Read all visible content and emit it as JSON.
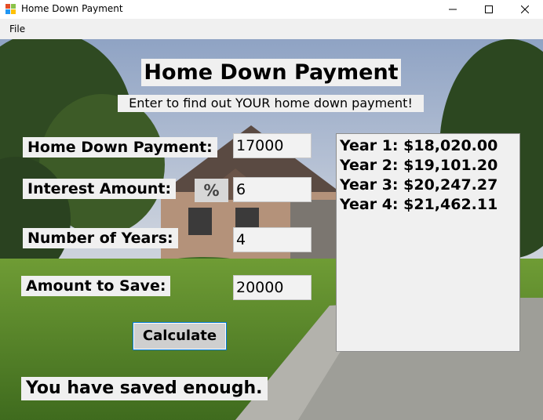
{
  "window": {
    "title": "Home Down Payment",
    "minimize_glyph": "—",
    "maximize_glyph": "☐",
    "close_glyph": "✕"
  },
  "menu": {
    "items": [
      {
        "label": "File"
      }
    ]
  },
  "form": {
    "title": "Home Down Payment",
    "subtitle": "Enter to find out YOUR home down payment!",
    "down_payment": {
      "label": "Home Down Payment:",
      "value": "17000"
    },
    "interest": {
      "label": "Interest Amount:",
      "symbol": "%",
      "value": "6"
    },
    "years": {
      "label": "Number of Years:",
      "value": "4"
    },
    "save": {
      "label": "Amount to Save:",
      "value": "20000"
    },
    "calculate_label": "Calculate",
    "result_text": "You have saved enough."
  },
  "results": [
    "Year 1: $18,020.00",
    "Year 2: $19,101.20",
    "Year 3: $20,247.27",
    "Year 4: $21,462.11"
  ],
  "colors": {
    "control_bg": "#f0f0f0",
    "button_focus_border": "#0078d7",
    "sky": "#b9c6d8",
    "lawn": "#5c8a2c"
  }
}
